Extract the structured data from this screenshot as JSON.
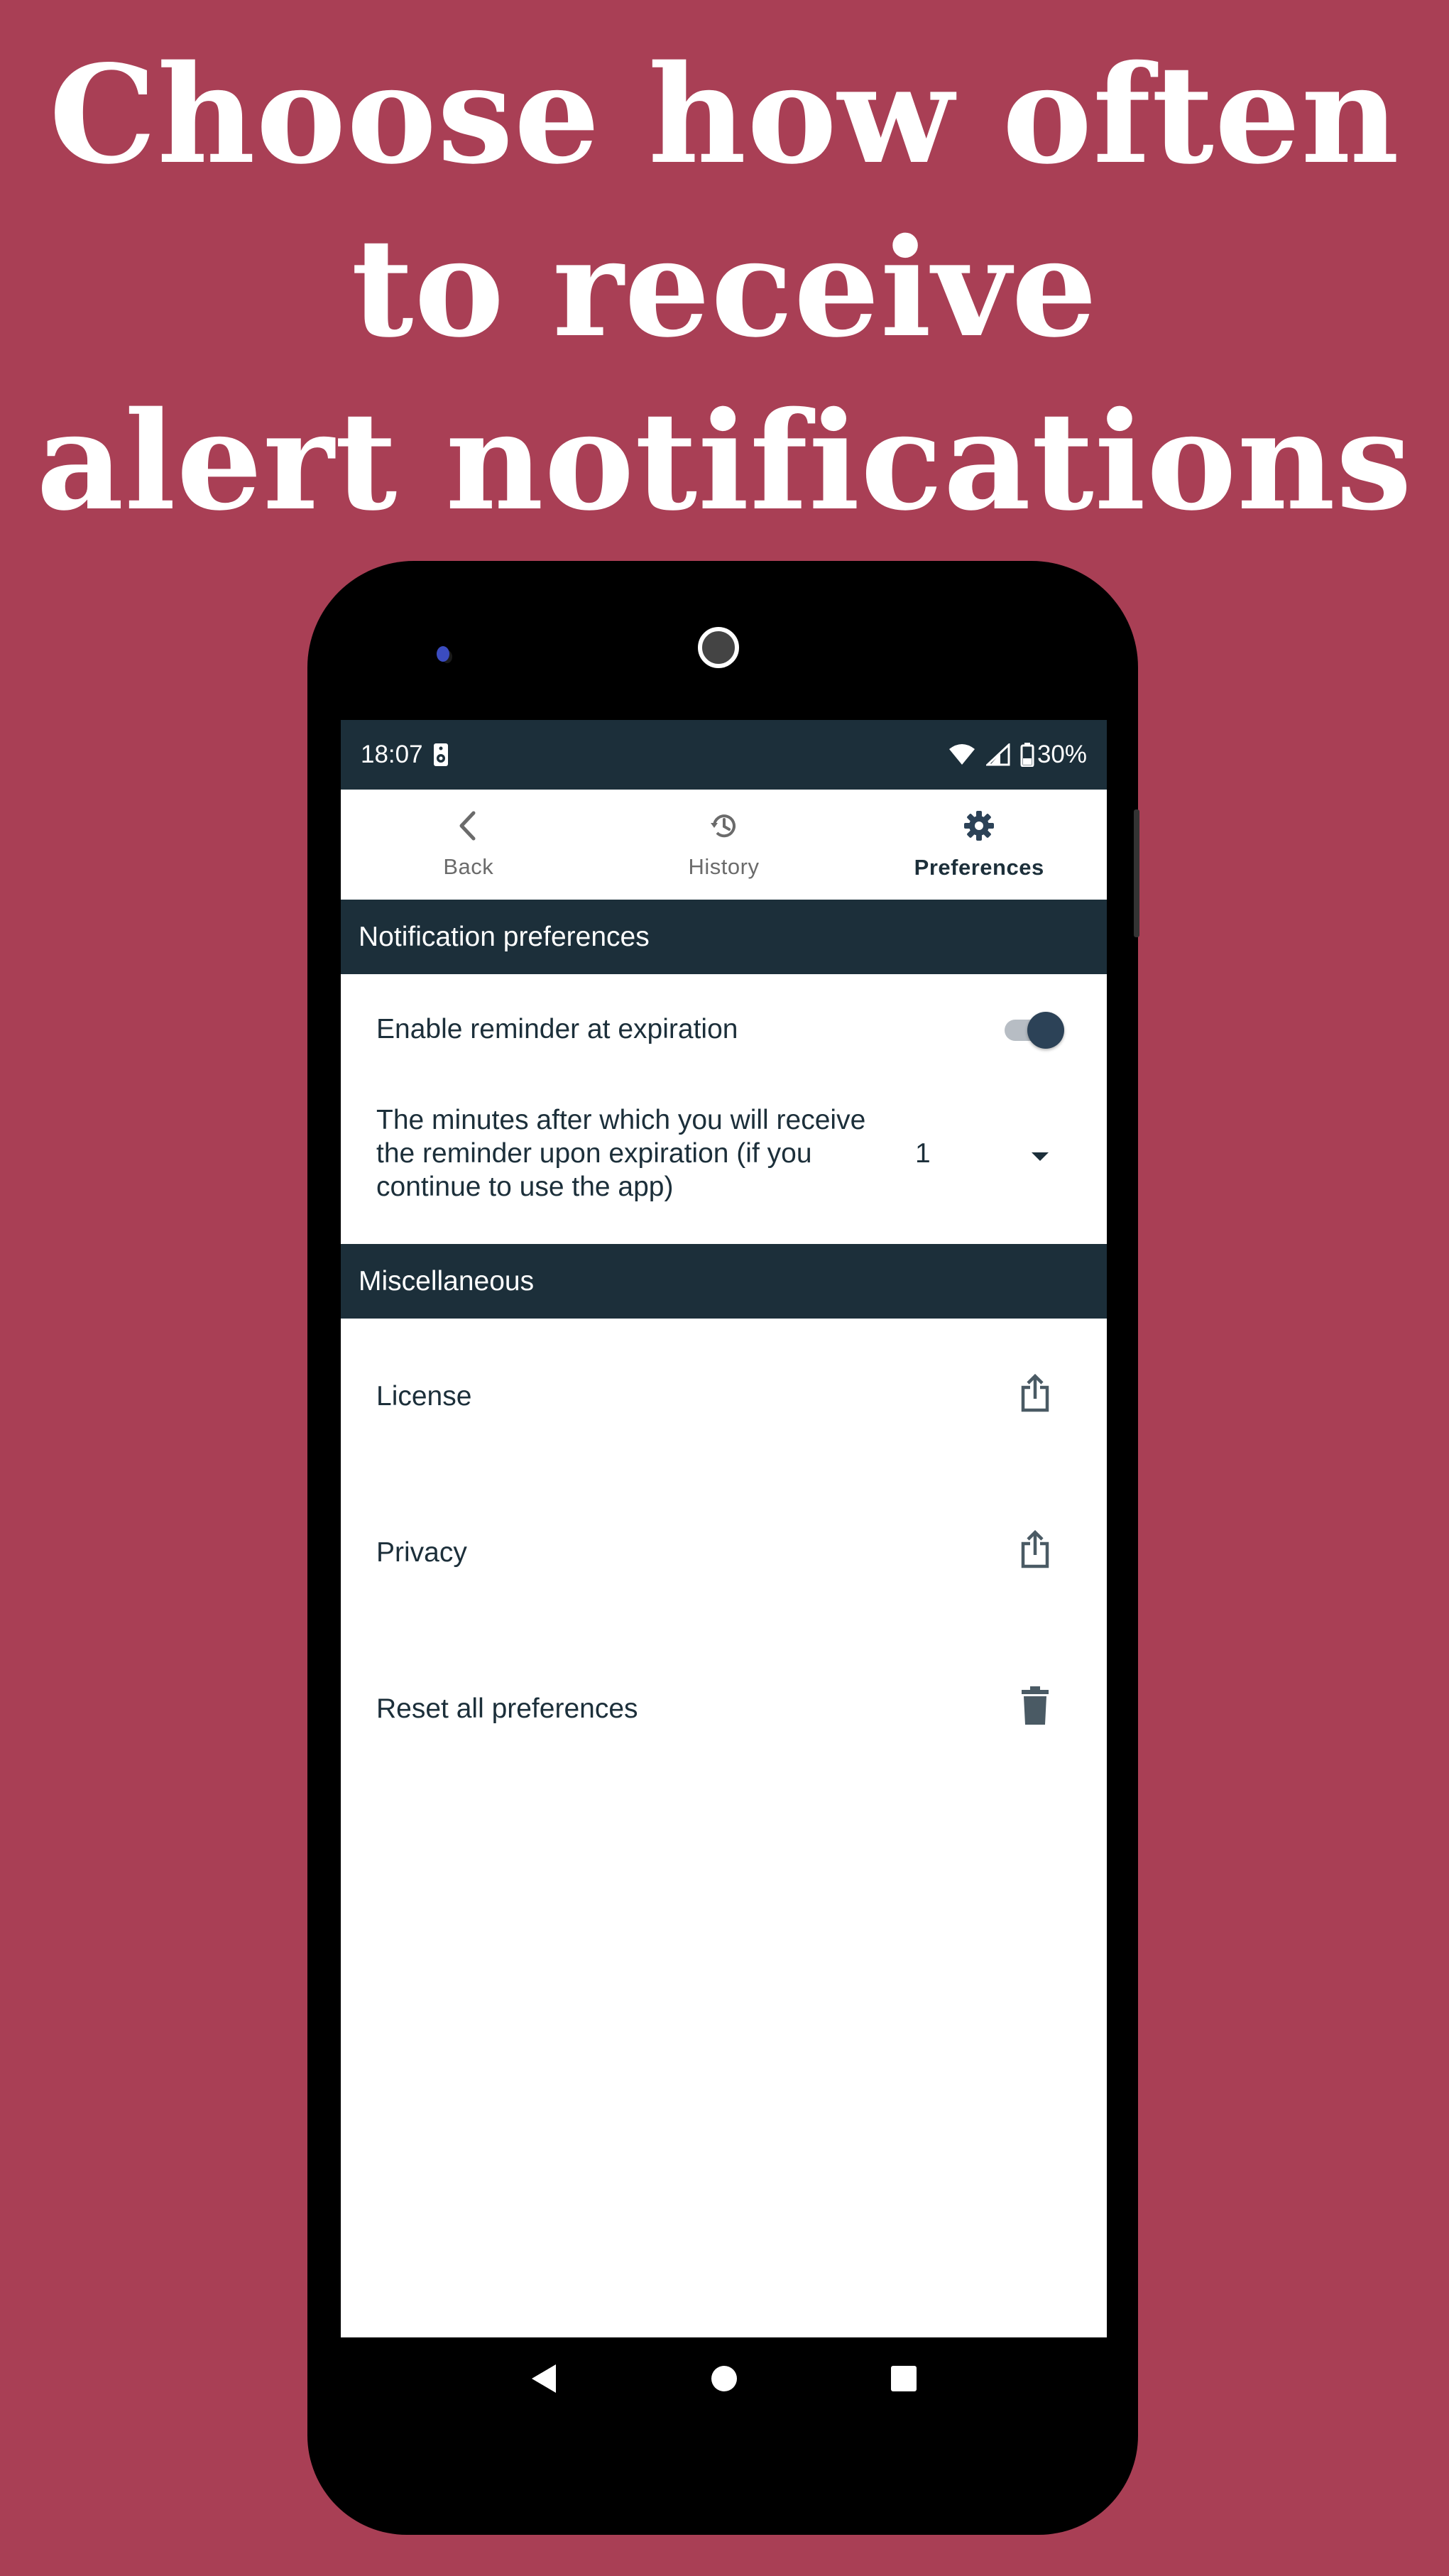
{
  "headline": {
    "line1": "Choose how often",
    "line2": "to receive",
    "line3": "alert notifications"
  },
  "status_bar": {
    "time": "18:07",
    "battery": "30%"
  },
  "tabs": [
    {
      "label": "Back",
      "icon": "chevron-left-icon",
      "active": false
    },
    {
      "label": "History",
      "icon": "history-icon",
      "active": false
    },
    {
      "label": "Preferences",
      "icon": "gear-icon",
      "active": true
    }
  ],
  "notification_section": {
    "title": "Notification preferences",
    "reminder_label": "Enable reminder at expiration",
    "reminder_enabled": true,
    "minutes_label": "The minutes after which you will receive the reminder upon expiration (if you continue to use the app)",
    "minutes_value": "1"
  },
  "misc_section": {
    "title": "Miscellaneous",
    "items": [
      {
        "label": "License",
        "icon": "share-icon"
      },
      {
        "label": "Privacy",
        "icon": "share-icon"
      },
      {
        "label": "Reset all preferences",
        "icon": "trash-icon"
      }
    ]
  },
  "colors": {
    "background": "#A93F55",
    "header": "#1C2F3A",
    "toggle_thumb": "#2c4257"
  }
}
